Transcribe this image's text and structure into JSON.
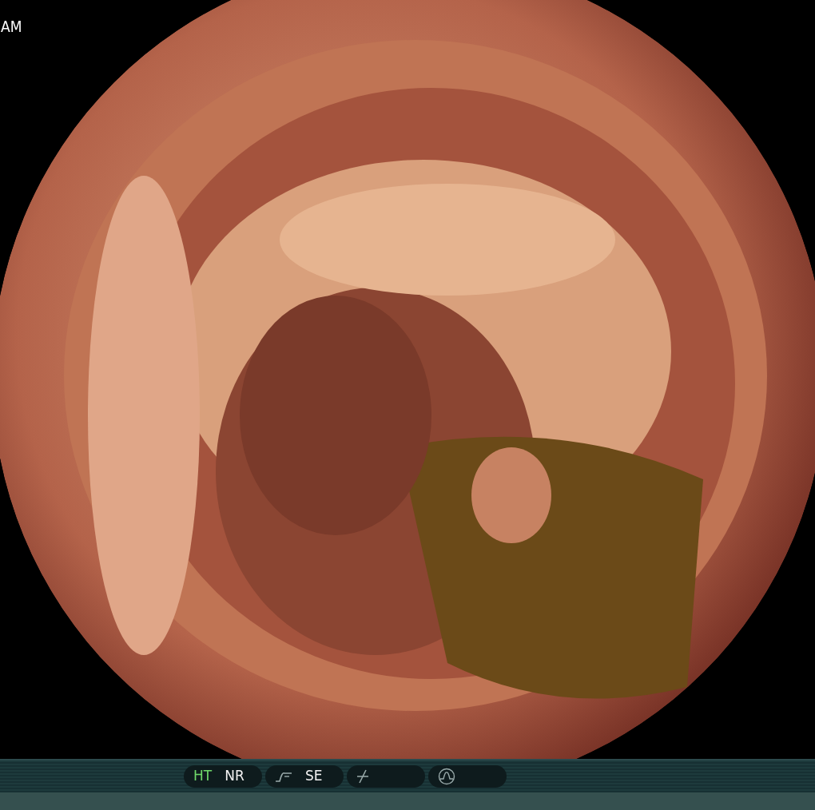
{
  "overlay_text": "AM",
  "status_bar": {
    "groups": [
      {
        "kind": "labels",
        "items": [
          {
            "label": "HT",
            "on": true
          },
          {
            "label": "NR",
            "on": false
          }
        ]
      },
      {
        "kind": "curve",
        "items": [
          {
            "label": "SE",
            "on": false
          }
        ]
      },
      {
        "kind": "slash"
      },
      {
        "kind": "wave"
      }
    ]
  }
}
